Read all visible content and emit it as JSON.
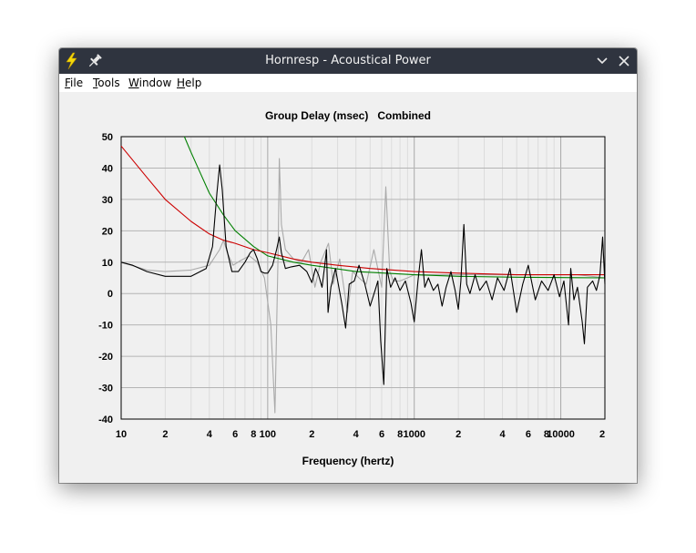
{
  "window": {
    "title": "Hornresp - Acoustical Power",
    "icons": {
      "app": "lightning-icon",
      "pin": "pin-icon",
      "minimize": "chevron-down-icon",
      "close": "close-icon"
    }
  },
  "menu": {
    "items": [
      {
        "mnemonic": "F",
        "rest": "ile"
      },
      {
        "mnemonic": "T",
        "rest": "ools"
      },
      {
        "mnemonic": "W",
        "rest": "indow"
      },
      {
        "mnemonic": "H",
        "rest": "elp"
      }
    ]
  },
  "chart_data": {
    "type": "line",
    "title": "Group Delay (msec)   Combined",
    "xlabel": "Frequency (hertz)",
    "ylabel": "",
    "x_scale": "log",
    "xlim": [
      10,
      20000
    ],
    "ylim": [
      -40,
      50
    ],
    "grid": true,
    "y_ticks": [
      "50",
      "40",
      "30",
      "20",
      "10",
      "0",
      "-10",
      "-20",
      "-30",
      "-40"
    ],
    "x_ticks": [
      {
        "value": 10,
        "label": "10"
      },
      {
        "value": 20,
        "label": "2"
      },
      {
        "value": 40,
        "label": "4"
      },
      {
        "value": 60,
        "label": "6"
      },
      {
        "value": 80,
        "label": "8"
      },
      {
        "value": 100,
        "label": "100"
      },
      {
        "value": 200,
        "label": "2"
      },
      {
        "value": 400,
        "label": "4"
      },
      {
        "value": 600,
        "label": "6"
      },
      {
        "value": 800,
        "label": "8"
      },
      {
        "value": 1000,
        "label": "1000"
      },
      {
        "value": 2000,
        "label": "2"
      },
      {
        "value": 4000,
        "label": "4"
      },
      {
        "value": 6000,
        "label": "6"
      },
      {
        "value": 8000,
        "label": "8"
      },
      {
        "value": 10000,
        "label": "10000"
      },
      {
        "value": 20000,
        "label": "2"
      }
    ],
    "series": [
      {
        "color": "#aaaaaa",
        "points": [
          [
            10,
            10
          ],
          [
            15,
            7.5
          ],
          [
            20,
            7
          ],
          [
            30,
            7.5
          ],
          [
            40,
            9
          ],
          [
            47,
            14
          ],
          [
            50,
            17
          ],
          [
            53,
            13
          ],
          [
            58,
            9
          ],
          [
            65,
            10.5
          ],
          [
            75,
            12
          ],
          [
            85,
            10
          ],
          [
            95,
            5
          ],
          [
            105,
            -10
          ],
          [
            112,
            -38
          ],
          [
            118,
            15
          ],
          [
            120,
            43
          ],
          [
            124,
            22
          ],
          [
            132,
            14
          ],
          [
            150,
            11
          ],
          [
            170,
            10
          ],
          [
            190,
            14
          ],
          [
            210,
            2
          ],
          [
            230,
            10
          ],
          [
            260,
            16
          ],
          [
            280,
            3
          ],
          [
            310,
            11
          ],
          [
            350,
            -6
          ],
          [
            380,
            7
          ],
          [
            420,
            5
          ],
          [
            470,
            3
          ],
          [
            530,
            14
          ],
          [
            600,
            2
          ],
          [
            640,
            34
          ],
          [
            680,
            7
          ],
          [
            720,
            4
          ],
          [
            800,
            4
          ],
          [
            900,
            5
          ],
          [
            1000,
            6
          ],
          [
            1300,
            6
          ],
          [
            1800,
            6
          ],
          [
            3000,
            6
          ],
          [
            6000,
            6
          ],
          [
            9000,
            6
          ],
          [
            13000,
            6
          ],
          [
            20000,
            5
          ]
        ]
      },
      {
        "color": "#008000",
        "points": [
          [
            27,
            50
          ],
          [
            30,
            45
          ],
          [
            35,
            38
          ],
          [
            40,
            32
          ],
          [
            50,
            25
          ],
          [
            60,
            20
          ],
          [
            80,
            15
          ],
          [
            100,
            12
          ],
          [
            150,
            10
          ],
          [
            200,
            9
          ],
          [
            400,
            7
          ],
          [
            1000,
            6
          ],
          [
            2000,
            5.5
          ],
          [
            5000,
            5.2
          ],
          [
            20000,
            5
          ]
        ]
      },
      {
        "color": "#cc0000",
        "points": [
          [
            10,
            47
          ],
          [
            15,
            37
          ],
          [
            20,
            30
          ],
          [
            30,
            23
          ],
          [
            40,
            19
          ],
          [
            50,
            17
          ],
          [
            60,
            16
          ],
          [
            80,
            14
          ],
          [
            100,
            13
          ],
          [
            150,
            11
          ],
          [
            200,
            10
          ],
          [
            300,
            9
          ],
          [
            500,
            8
          ],
          [
            1000,
            7
          ],
          [
            2000,
            6.5
          ],
          [
            5000,
            6
          ],
          [
            10000,
            6
          ],
          [
            20000,
            6
          ]
        ]
      },
      {
        "color": "#000000",
        "points": [
          [
            10,
            10
          ],
          [
            12,
            9
          ],
          [
            15,
            7
          ],
          [
            20,
            5.5
          ],
          [
            30,
            5.5
          ],
          [
            38,
            8
          ],
          [
            42,
            15
          ],
          [
            45,
            32
          ],
          [
            47,
            41
          ],
          [
            49,
            33
          ],
          [
            52,
            15
          ],
          [
            57,
            7
          ],
          [
            63,
            7
          ],
          [
            70,
            10
          ],
          [
            76,
            13
          ],
          [
            80,
            14
          ],
          [
            85,
            11
          ],
          [
            90,
            7
          ],
          [
            95,
            6.5
          ],
          [
            100,
            6.5
          ],
          [
            108,
            9
          ],
          [
            115,
            14
          ],
          [
            120,
            18
          ],
          [
            124,
            13
          ],
          [
            132,
            8
          ],
          [
            145,
            8.5
          ],
          [
            165,
            9
          ],
          [
            185,
            7
          ],
          [
            200,
            3.5
          ],
          [
            212,
            8
          ],
          [
            222,
            6
          ],
          [
            235,
            2
          ],
          [
            245,
            9
          ],
          [
            252,
            14
          ],
          [
            258,
            -6
          ],
          [
            270,
            2
          ],
          [
            290,
            8
          ],
          [
            320,
            -3
          ],
          [
            340,
            -11
          ],
          [
            360,
            3
          ],
          [
            390,
            4
          ],
          [
            420,
            9
          ],
          [
            460,
            3
          ],
          [
            500,
            -4
          ],
          [
            540,
            1
          ],
          [
            565,
            4
          ],
          [
            590,
            -15
          ],
          [
            620,
            -29
          ],
          [
            650,
            8
          ],
          [
            690,
            2
          ],
          [
            740,
            5
          ],
          [
            800,
            1
          ],
          [
            870,
            4
          ],
          [
            950,
            -3
          ],
          [
            1000,
            -9
          ],
          [
            1060,
            4
          ],
          [
            1120,
            14
          ],
          [
            1180,
            2
          ],
          [
            1250,
            5
          ],
          [
            1350,
            1
          ],
          [
            1450,
            3
          ],
          [
            1550,
            -4
          ],
          [
            1650,
            2
          ],
          [
            1780,
            7
          ],
          [
            1900,
            1
          ],
          [
            2000,
            -5
          ],
          [
            2080,
            4
          ],
          [
            2180,
            22
          ],
          [
            2280,
            3
          ],
          [
            2400,
            0
          ],
          [
            2600,
            6
          ],
          [
            2800,
            1
          ],
          [
            3100,
            4
          ],
          [
            3400,
            -2
          ],
          [
            3700,
            5
          ],
          [
            4100,
            1
          ],
          [
            4500,
            8
          ],
          [
            5000,
            -6
          ],
          [
            5500,
            3
          ],
          [
            6000,
            9
          ],
          [
            6700,
            -2
          ],
          [
            7400,
            4
          ],
          [
            8200,
            1
          ],
          [
            9000,
            6
          ],
          [
            9800,
            -1
          ],
          [
            10500,
            4
          ],
          [
            11300,
            -10
          ],
          [
            11700,
            8
          ],
          [
            12300,
            -2
          ],
          [
            13000,
            2
          ],
          [
            14000,
            -9
          ],
          [
            14500,
            -16
          ],
          [
            15200,
            2
          ],
          [
            16500,
            4
          ],
          [
            17500,
            1
          ],
          [
            18500,
            6
          ],
          [
            19300,
            18
          ],
          [
            20000,
            3
          ]
        ]
      }
    ]
  }
}
